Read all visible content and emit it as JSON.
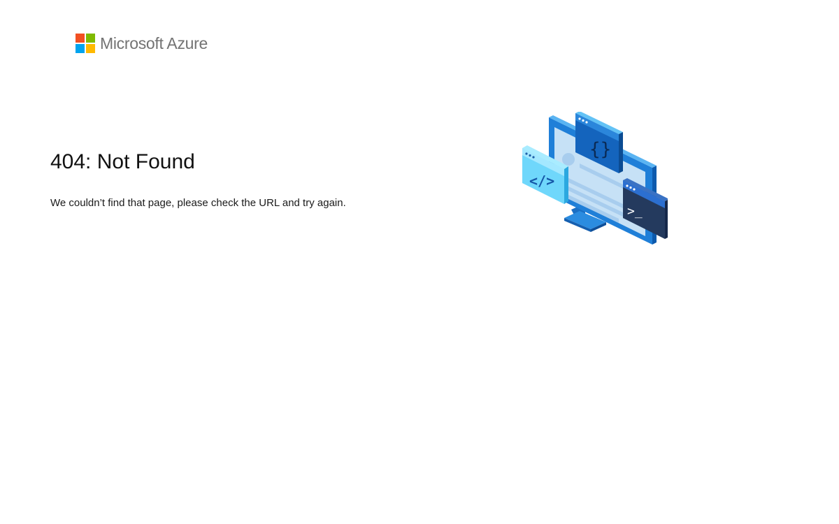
{
  "brand": {
    "name": "Microsoft Azure",
    "logo_colors": [
      "#f25022",
      "#7fba00",
      "#00a4ef",
      "#ffb900"
    ]
  },
  "error": {
    "title": "404: Not Found",
    "message": "We couldn’t find that page, please check the URL and try again."
  },
  "illustration": {
    "icon": "developer-windows-illustration",
    "code_glyph": "</>",
    "braces_glyph": "{}",
    "prompt_glyph": ">_"
  },
  "colors": {
    "accent": "#0078d4",
    "light_blue": "#50e6ff",
    "navy": "#243a5e",
    "text": "#111111"
  }
}
